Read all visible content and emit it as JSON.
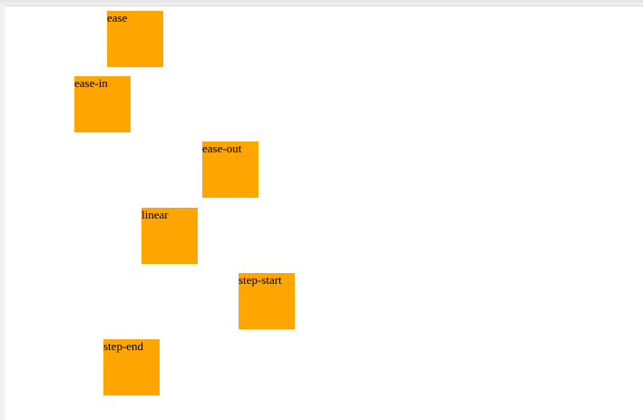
{
  "box_color": "#ffa500",
  "boxes": [
    {
      "label": "ease"
    },
    {
      "label": "ease-in"
    },
    {
      "label": "ease-out"
    },
    {
      "label": "linear"
    },
    {
      "label": "step-start"
    },
    {
      "label": "step-end"
    }
  ]
}
